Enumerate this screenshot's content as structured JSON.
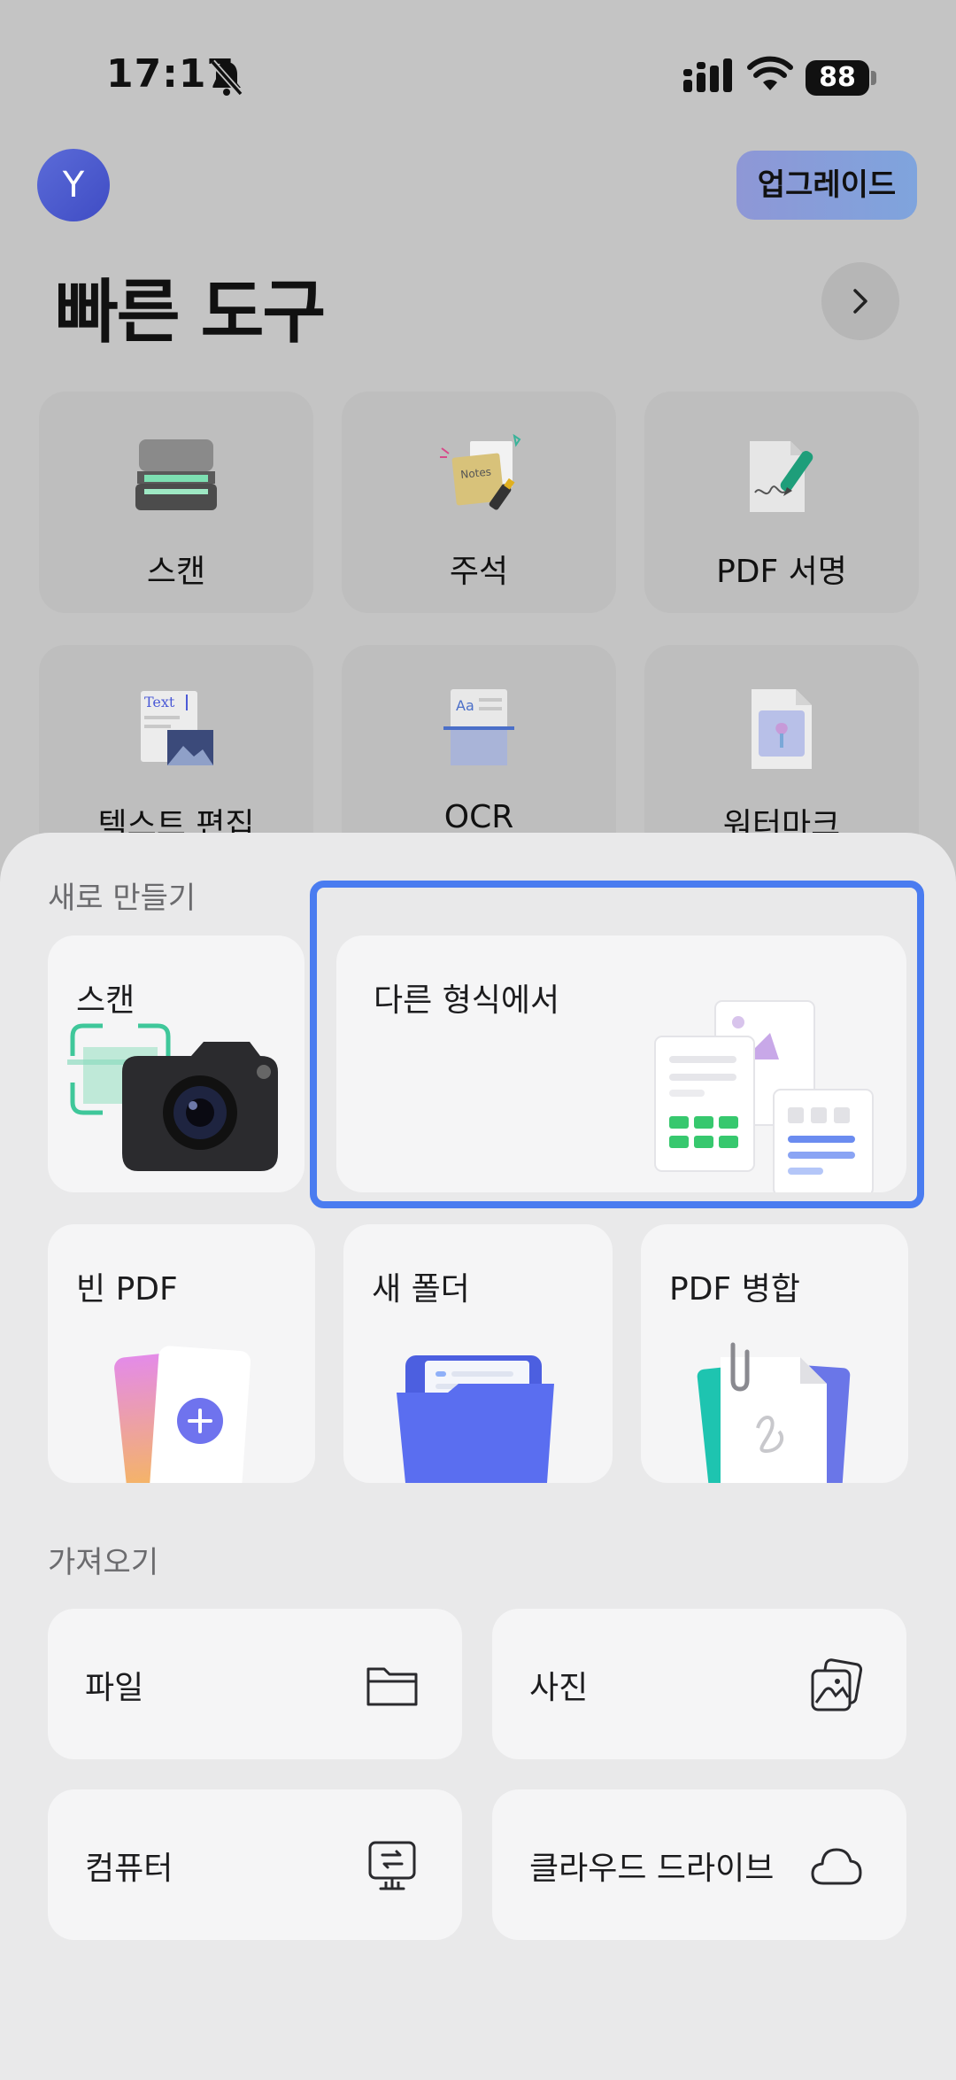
{
  "status_bar": {
    "time": "17:17",
    "battery": "88"
  },
  "header": {
    "avatar_letter": "Y",
    "upgrade_label": "업그레이드"
  },
  "quick_tools": {
    "title": "빠른 도구",
    "items": [
      {
        "label": "스캔",
        "icon": "scanner-icon"
      },
      {
        "label": "주석",
        "icon": "notes-icon"
      },
      {
        "label": "PDF 서명",
        "icon": "signature-icon"
      },
      {
        "label": "텍스트 편집",
        "icon": "text-edit-icon"
      },
      {
        "label": "OCR",
        "icon": "ocr-icon"
      },
      {
        "label": "워터마크",
        "icon": "watermark-icon"
      }
    ]
  },
  "create_new": {
    "title": "새로 만들기",
    "scan_label": "스캔",
    "from_format_label": "다른 형식에서",
    "blank_pdf_label": "빈 PDF",
    "new_folder_label": "새 폴더",
    "merge_pdf_label": "PDF 병합"
  },
  "import": {
    "title": "가져오기",
    "items": [
      {
        "label": "파일",
        "icon": "folder-icon"
      },
      {
        "label": "사진",
        "icon": "photo-icon"
      },
      {
        "label": "컴퓨터",
        "icon": "computer-transfer-icon"
      },
      {
        "label": "클라우드 드라이브",
        "icon": "cloud-icon"
      }
    ]
  },
  "colors": {
    "accent": "#4a7cf0",
    "sheet_bg": "#e9e9ea",
    "card_bg": "#f5f5f6",
    "dim_bg": "#c4c4c4"
  }
}
